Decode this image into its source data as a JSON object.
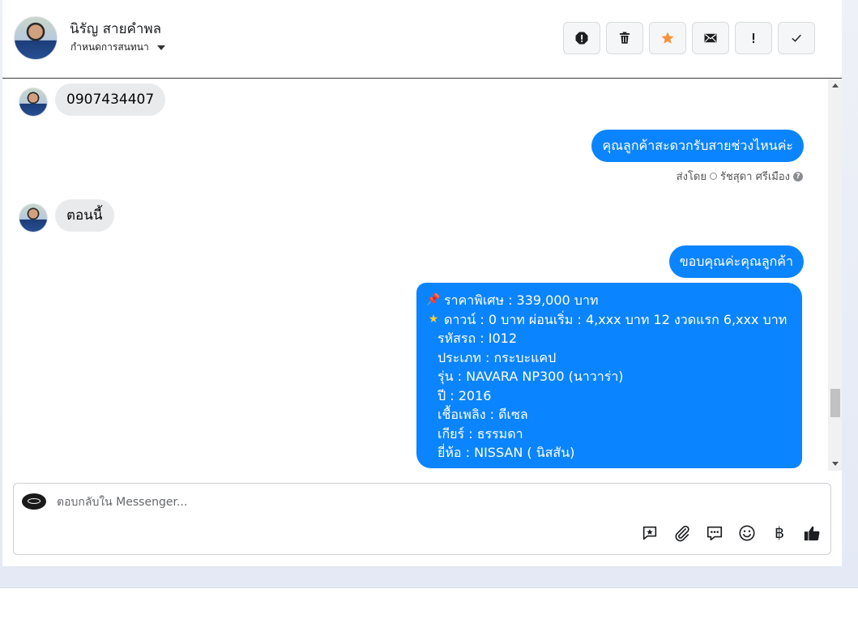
{
  "header": {
    "contact_name": "นิรัญ สายคำพล",
    "assign_label": "กำหนดการสนทนา",
    "actions": [
      {
        "name": "report-spam",
        "icon": "alert-octagon-icon"
      },
      {
        "name": "delete",
        "icon": "trash-icon"
      },
      {
        "name": "star",
        "icon": "star-icon"
      },
      {
        "name": "mark-unread",
        "icon": "envelope-icon"
      },
      {
        "name": "mark-important",
        "icon": "exclamation-icon"
      },
      {
        "name": "mark-done",
        "icon": "check-icon"
      }
    ]
  },
  "messages": {
    "m1": "0907434407",
    "m2": "คุณลูกค้าสะดวกรับสายช่วงไหนค่ะ",
    "sent_by_label": "ส่งโดย",
    "sent_by_name": "รัชสุดา ศรีเมือง",
    "m3": "ตอนนี้",
    "m4": "ขอบคุณค่ะคุณลูกค้า",
    "m5": {
      "l1": "ราคาพิเศษ : 339,000 บาท",
      "l2": "ดาวน์ : 0 บาท ผ่อนเริ่ม : 4,xxx บาท 12 งวดแรก  6,xxx บาท",
      "l3": "รหัสรถ : I012",
      "l4": "ประเภท : กระบะแคป",
      "l5": "รุ่น : NAVARA NP300 (นาวาร่า)",
      "l6": "ปี : 2016",
      "l7": "เชื้อเพลิง : ดีเซล",
      "l8": "เกียร์ : ธรรมดา",
      "l9": "ยี่ห้อ : NISSAN ( นิสสัน)"
    },
    "m5_icons": [
      "pushpin-icon",
      "star-icon"
    ]
  },
  "composer": {
    "placeholder": "ตอบกลับใน Messenger...",
    "tools": [
      "saved-reply-icon",
      "attach-icon",
      "quick-reply-icon",
      "emoji-icon",
      "baht-payment-icon",
      "thumbs-up-icon"
    ],
    "baht_symbol": "฿"
  },
  "colors": {
    "outgoing_bubble": "#0b84ff",
    "incoming_bubble": "#e9eaec",
    "star": "#f7923a"
  }
}
